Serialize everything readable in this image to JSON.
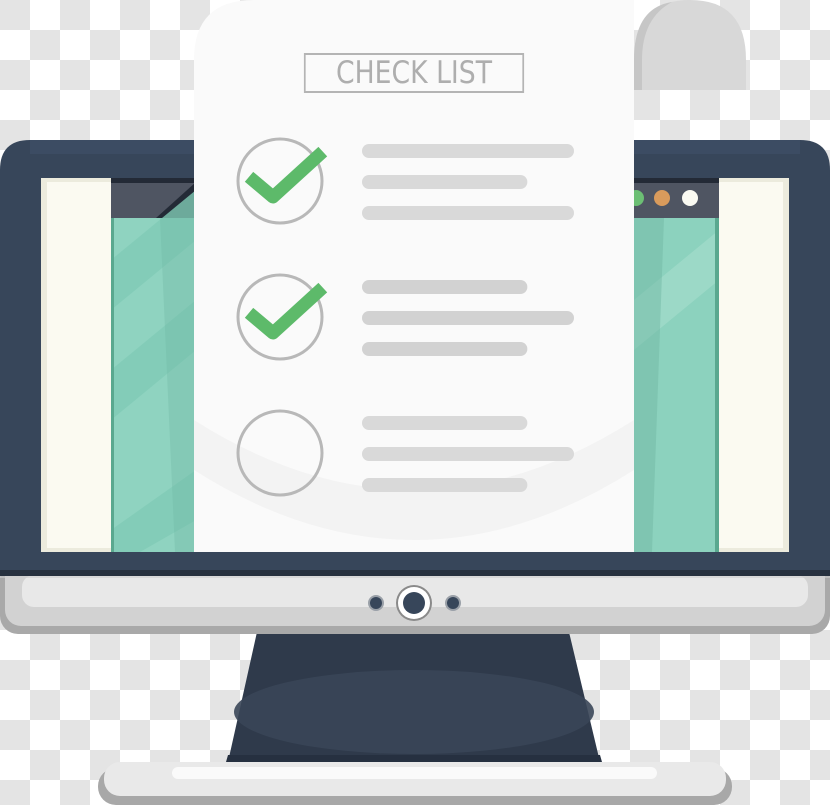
{
  "checklist": {
    "title": "CHECK LIST",
    "items": [
      {
        "checked": true,
        "lines": [
          1.0,
          0.78,
          1.0
        ]
      },
      {
        "checked": true,
        "lines": [
          0.78,
          1.0,
          0.78
        ]
      },
      {
        "checked": false,
        "lines": [
          0.78,
          1.0,
          0.78
        ]
      }
    ]
  },
  "browser": {
    "window_dots": [
      {
        "name": "green",
        "color": "#6cbf74"
      },
      {
        "name": "orange",
        "color": "#d99b5c"
      },
      {
        "name": "white",
        "color": "#fafaf2"
      }
    ]
  },
  "colors": {
    "monitor_bezel": "#37465a",
    "monitor_chin": "#e6e6e6",
    "screen_teal": "#8ad2be",
    "paper": "#fafafa",
    "check_green": "#5dba6a",
    "line_gray": "#d9d9d9",
    "circle_gray": "#b8b8b8"
  }
}
